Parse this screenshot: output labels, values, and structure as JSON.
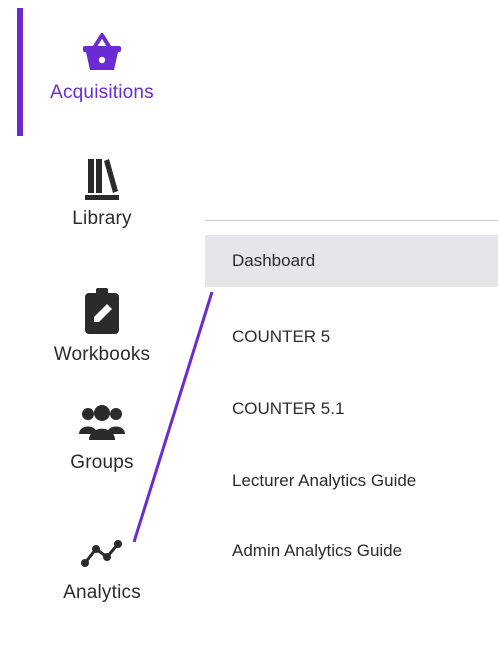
{
  "colors": {
    "accent": "#6a2bd4",
    "icon": "#2b2b2b",
    "hover_bg": "#e5e6e9"
  },
  "sidebar": {
    "items": [
      {
        "label": "Acquisitions",
        "icon": "basket-icon",
        "active": true
      },
      {
        "label": "Library",
        "icon": "books-icon",
        "active": false
      },
      {
        "label": "Workbooks",
        "icon": "clipboard-pencil-icon",
        "active": false
      },
      {
        "label": "Groups",
        "icon": "users-icon",
        "active": false
      },
      {
        "label": "Analytics",
        "icon": "trend-line-icon",
        "active": false
      }
    ]
  },
  "submenu": {
    "items": [
      {
        "label": "Dashboard",
        "highlighted": true
      },
      {
        "label": "COUNTER 5",
        "highlighted": false
      },
      {
        "label": "COUNTER 5.1",
        "highlighted": false
      },
      {
        "label": "Lecturer Analytics Guide",
        "highlighted": false
      },
      {
        "label": "Admin Analytics Guide",
        "highlighted": false
      }
    ]
  }
}
